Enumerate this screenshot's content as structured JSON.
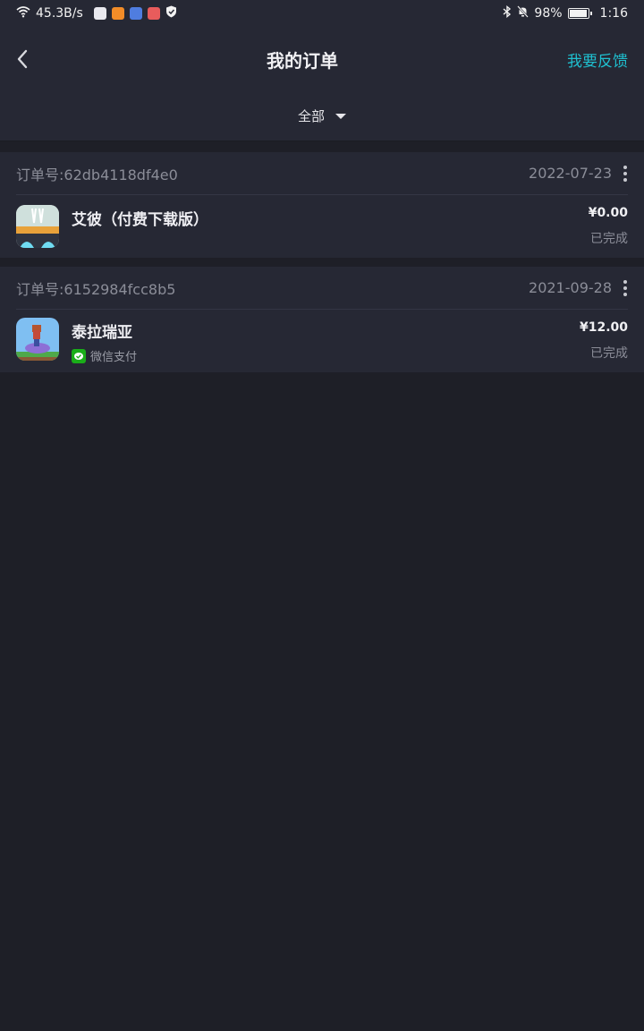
{
  "status_bar": {
    "speed": "45.3B/s",
    "battery": "98%",
    "battery_level": 0.98,
    "time": "1:16",
    "icons": [
      "wifi-icon",
      "mail-icon",
      "play-app-icon",
      "browser-app-icon",
      "red-app-icon",
      "shield-icon",
      "bluetooth-icon",
      "mute-bell-icon",
      "battery-icon"
    ]
  },
  "header": {
    "title": "我的订单",
    "feedback": "我要反馈"
  },
  "filter": {
    "selected": "全部"
  },
  "orders": [
    {
      "order_no_label": "订单号:",
      "order_no": "62db4118df4e0",
      "date": "2022-07-23",
      "product": "艾彼（付费下载版）",
      "price": "¥0.00",
      "status": "已完成",
      "payment": ""
    },
    {
      "order_no_label": "订单号:",
      "order_no": "6152984fcc8b5",
      "date": "2021-09-28",
      "product": "泰拉瑞亚",
      "price": "¥12.00",
      "status": "已完成",
      "payment": "微信支付"
    }
  ],
  "colors": {
    "accent": "#1fbfcf",
    "background": "#1e1f27",
    "card": "#262834",
    "wechat_green": "#1aad19"
  }
}
